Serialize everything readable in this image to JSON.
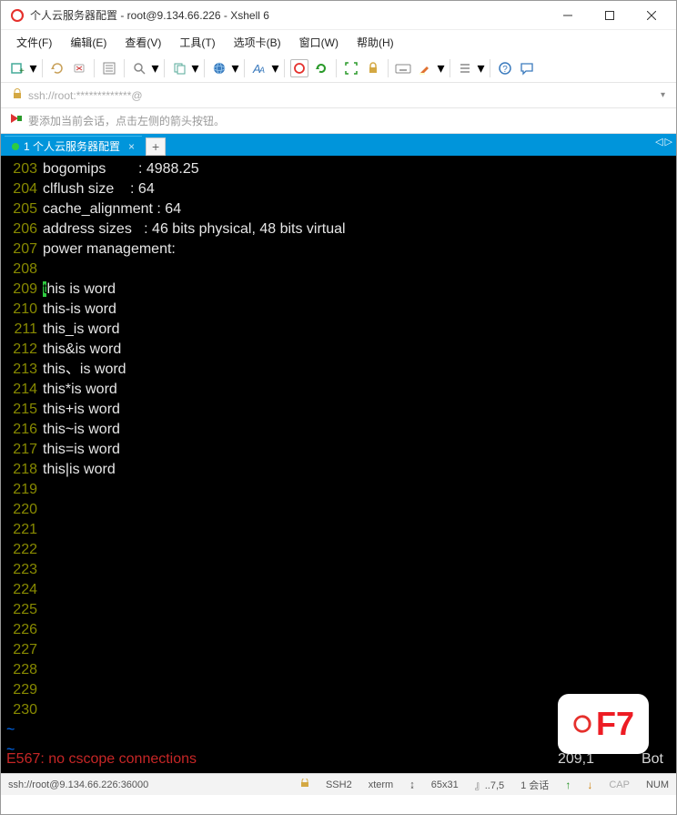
{
  "titlebar": {
    "title": "个人云服务器配置 - root@9.134.66.226 - Xshell 6"
  },
  "menubar": {
    "file": "文件(F)",
    "edit": "编辑(E)",
    "view": "查看(V)",
    "tools": "工具(T)",
    "options": "选项卡(B)",
    "window": "窗口(W)",
    "help": "帮助(H)"
  },
  "addrbar": {
    "url": "ssh://root:*************@"
  },
  "tipbar": {
    "text": "要添加当前会话，点击左侧的箭头按钮。"
  },
  "tab": {
    "label": "1 个人云服务器配置"
  },
  "terminal": {
    "lines": [
      {
        "n": "203",
        "t": "bogomips        : 4988.25"
      },
      {
        "n": "204",
        "t": "clflush size    : 64"
      },
      {
        "n": "205",
        "t": "cache_alignment : 64"
      },
      {
        "n": "206",
        "t": "address sizes   : 46 bits physical, 48 bits virtual"
      },
      {
        "n": "207",
        "t": "power management:"
      },
      {
        "n": "208",
        "t": ""
      },
      {
        "n": "209",
        "cursor": "t",
        "rest": "his is word"
      },
      {
        "n": "210",
        "t": "this-is word"
      },
      {
        "n": "211",
        "t": "this_is word"
      },
      {
        "n": "212",
        "t": "this&is word"
      },
      {
        "n": "213",
        "t": "this、is word"
      },
      {
        "n": "214",
        "t": "this*is word"
      },
      {
        "n": "215",
        "t": "this+is word"
      },
      {
        "n": "216",
        "t": "this~is word"
      },
      {
        "n": "217",
        "t": "this=is word"
      },
      {
        "n": "218",
        "t": "this|is word"
      },
      {
        "n": "219",
        "t": ""
      },
      {
        "n": "220",
        "t": ""
      },
      {
        "n": "221",
        "t": ""
      },
      {
        "n": "222",
        "t": ""
      },
      {
        "n": "223",
        "t": ""
      },
      {
        "n": "224",
        "t": ""
      },
      {
        "n": "225",
        "t": ""
      },
      {
        "n": "226",
        "t": ""
      },
      {
        "n": "227",
        "t": ""
      },
      {
        "n": "228",
        "t": ""
      },
      {
        "n": "229",
        "t": ""
      },
      {
        "n": "230",
        "t": ""
      }
    ],
    "msg": "E567: no cscope connections",
    "pos": "209,1",
    "bot": "Bot"
  },
  "f7": {
    "label": "F7"
  },
  "statusbar": {
    "conn": "ssh://root@9.134.66.226:36000",
    "proto": "SSH2",
    "term": "xterm",
    "size": "65x31",
    "enc": "7,5",
    "sessions": "1 会话",
    "cap": "CAP",
    "num": "NUM"
  }
}
